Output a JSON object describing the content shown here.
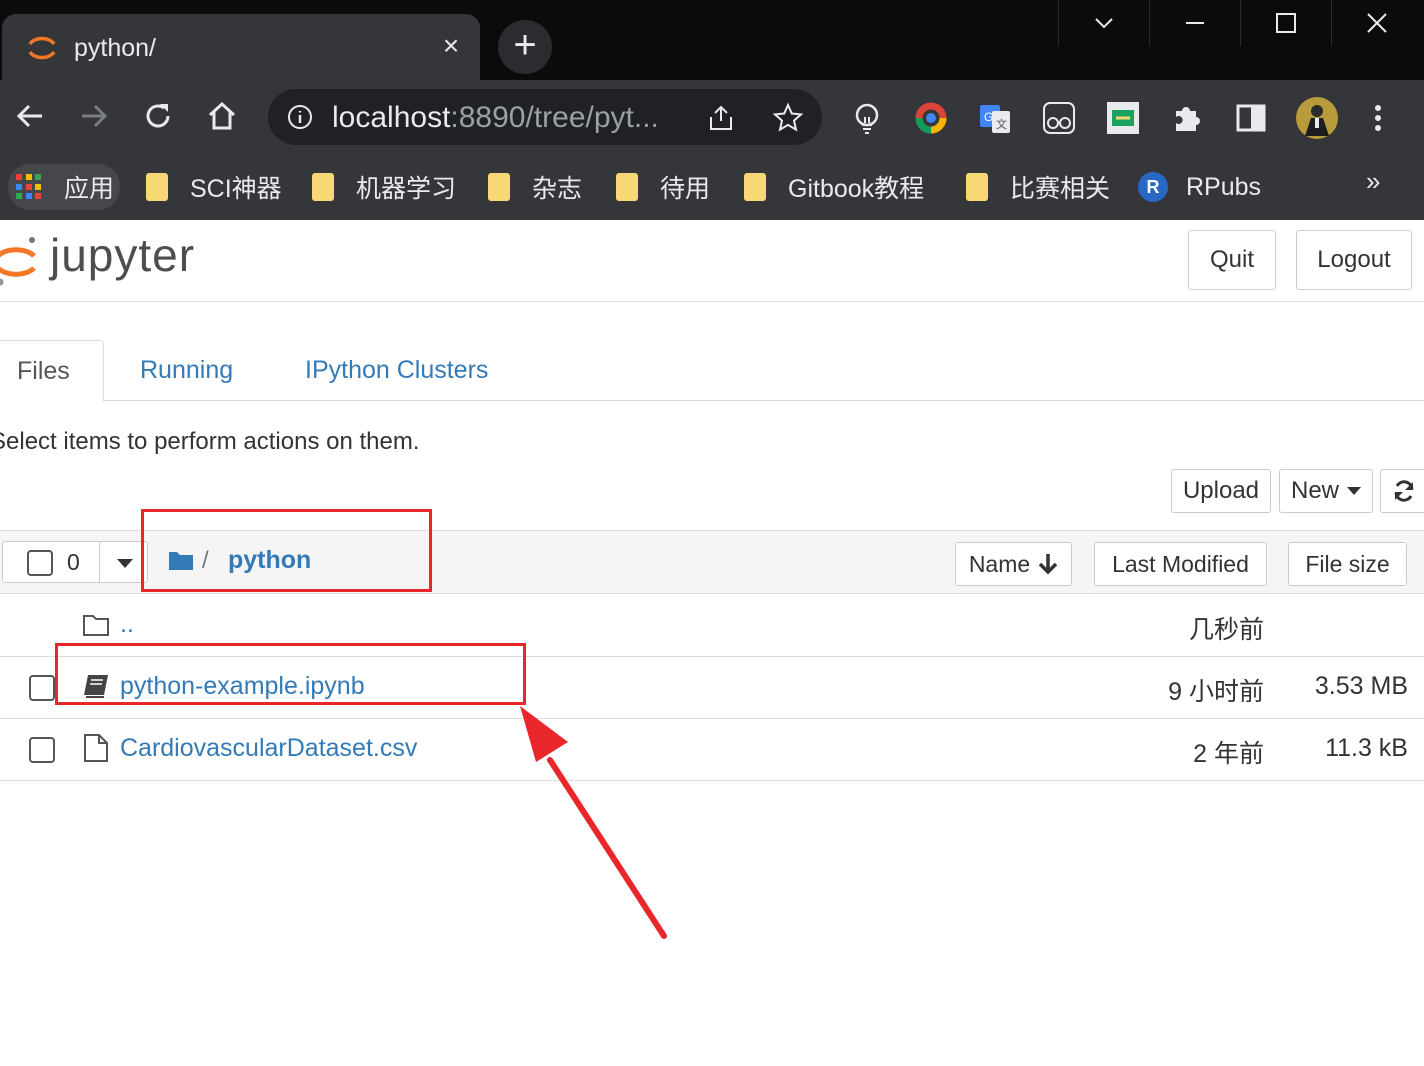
{
  "browser": {
    "tab_title": "python/",
    "tab_close": "×",
    "new_tab": "+",
    "url_host": "localhost",
    "url_rest": ":8890/tree/pyt...",
    "bookmarks": {
      "apps": "应用",
      "items": [
        "SCI神器",
        "机器学习",
        "杂志",
        "待用",
        "Gitbook教程",
        "比赛相关"
      ],
      "rpubs": "RPubs",
      "rpubs_icon_letter": "R",
      "more": "»"
    }
  },
  "jupyter": {
    "logo_text": "jupyter",
    "quit": "Quit",
    "logout": "Logout",
    "tabs": {
      "files": "Files",
      "running": "Running",
      "clusters": "IPython Clusters"
    },
    "hint": "Select items to perform actions on them.",
    "upload": "Upload",
    "new": "New",
    "selected_count": "0",
    "breadcrumb_sep": "/",
    "breadcrumb_folder": "python",
    "sort": {
      "name": "Name",
      "last_modified": "Last Modified",
      "file_size": "File size"
    },
    "files": [
      {
        "name": "..",
        "modified": "几秒前",
        "size": "",
        "type": "parent"
      },
      {
        "name": "python-example.ipynb",
        "modified": "9 小时前",
        "size": "3.53 MB",
        "type": "notebook"
      },
      {
        "name": "CardiovascularDataset.csv",
        "modified": "2 年前",
        "size": "11.3 kB",
        "type": "file"
      }
    ]
  },
  "colors": {
    "link": "#337ab7",
    "annotation": "#e8262b",
    "chrome_dark": "#202124",
    "jupyter_orange": "#f37726"
  }
}
